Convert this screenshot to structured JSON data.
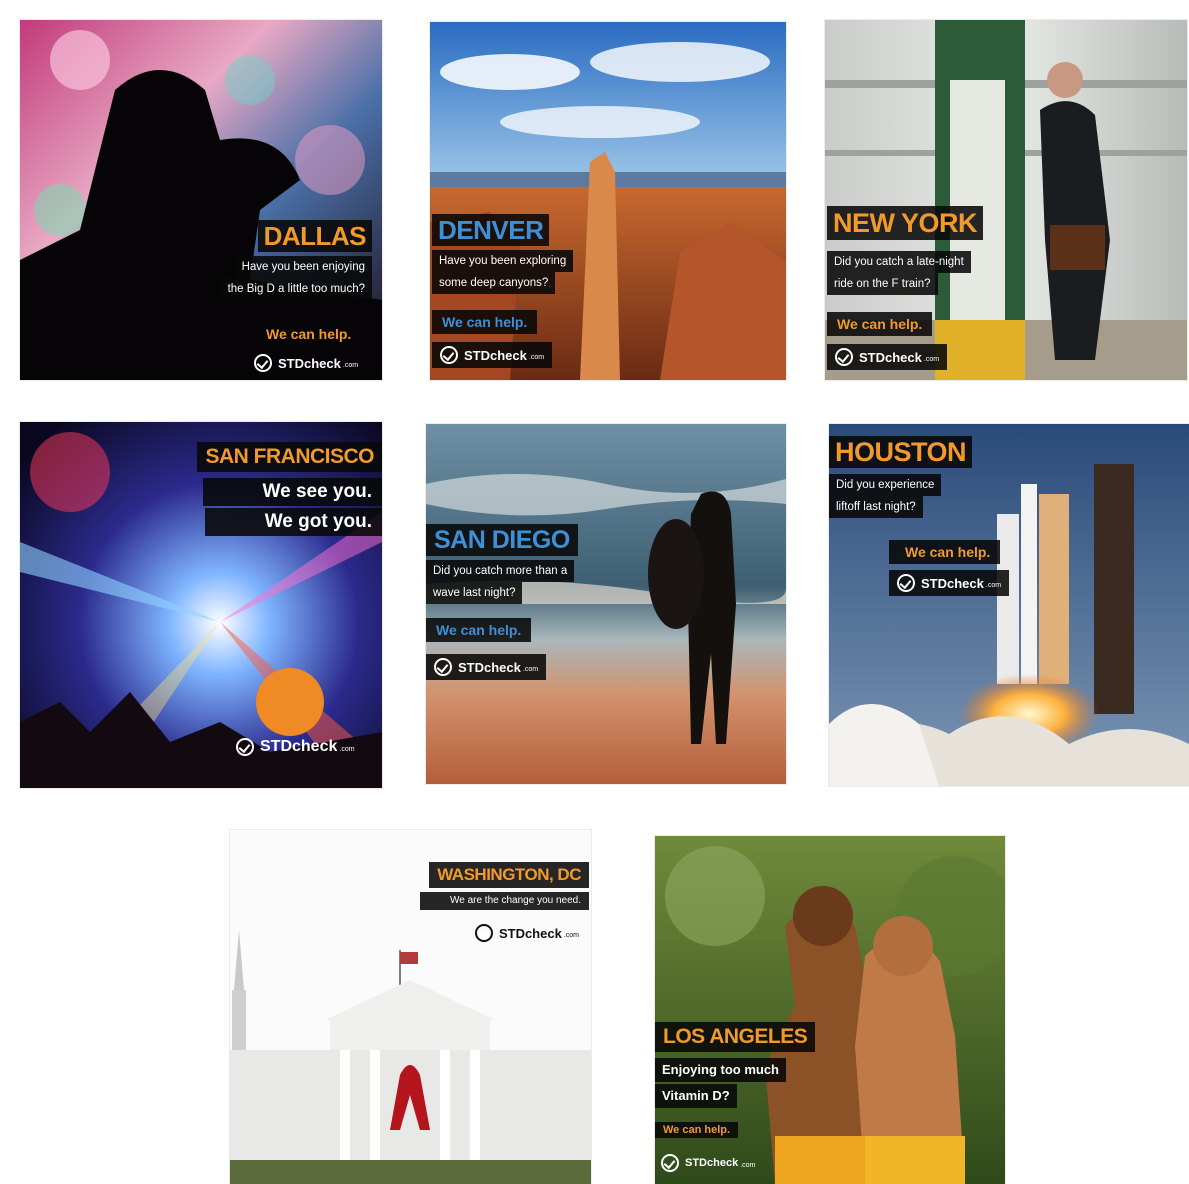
{
  "brand": {
    "logo_text": "STDcheck",
    "logo_suffix": ".com",
    "colors": {
      "orange": "#f19a2b",
      "blue": "#3f8fd6",
      "panel": "#080808"
    }
  },
  "ads": {
    "dallas": {
      "city": "DALLAS",
      "lines": [
        "Have you been enjoying",
        "the Big D a little too much?"
      ],
      "cta": "We can help."
    },
    "denver": {
      "city": "DENVER",
      "lines": [
        "Have you been exploring",
        "some deep canyons?"
      ],
      "cta": "We can help."
    },
    "newyork": {
      "city": "NEW YORK",
      "lines": [
        "Did you catch a late-night",
        "ride on the F train?"
      ],
      "cta": "We can help."
    },
    "sanfrancisco": {
      "city": "SAN FRANCISCO",
      "lines": [
        "We see you.",
        "We got you."
      ]
    },
    "sandiego": {
      "city": "SAN DIEGO",
      "lines": [
        "Did you catch more than a",
        "wave last night?"
      ],
      "cta": "We can help."
    },
    "houston": {
      "city": "HOUSTON",
      "lines": [
        "Did you experience",
        "liftoff last night?"
      ],
      "cta": "We can help."
    },
    "washington": {
      "city": "WASHINGTON, DC",
      "lines": [
        "We are the change you need."
      ]
    },
    "losangeles": {
      "city": "LOS ANGELES",
      "lines": [
        "Enjoying too much",
        "Vitamin D?"
      ],
      "cta": "We can help."
    }
  }
}
